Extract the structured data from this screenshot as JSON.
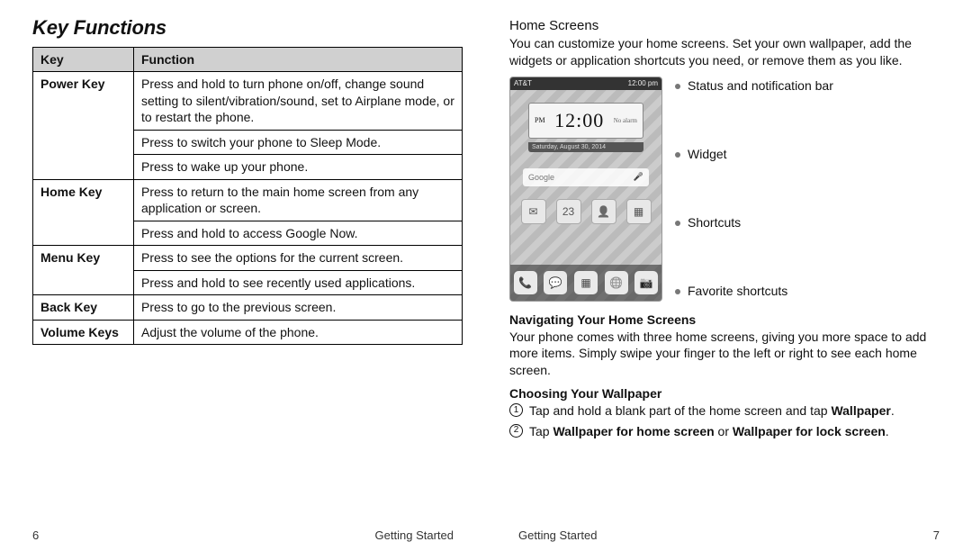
{
  "left": {
    "title": "Key Functions",
    "table": {
      "head": {
        "c1": "Key",
        "c2": "Function"
      },
      "rows": [
        {
          "key": "Power Key",
          "cells": [
            "Press and hold to turn phone on/off, change sound setting to silent/vibration/sound, set to Airplane mode, or to restart the phone.",
            "Press to switch your phone to Sleep Mode.",
            "Press to wake up your phone."
          ]
        },
        {
          "key": "Home Key",
          "cells": [
            "Press to return to the main home screen from any application or screen.",
            "Press and hold to access Google Now."
          ]
        },
        {
          "key": "Menu Key",
          "cells": [
            "Press to see the options for the current screen.",
            "Press and hold to see recently used applications."
          ]
        },
        {
          "key": "Back Key",
          "cells": [
            "Press to go to the previous screen."
          ]
        },
        {
          "key": "Volume Keys",
          "cells": [
            "Adjust the volume of the phone."
          ]
        }
      ]
    },
    "footer": {
      "pagenum": "6",
      "section": "Getting Started"
    }
  },
  "right": {
    "h1": "Home Screens",
    "p1": "You can customize your home screens. Set your own wallpaper, add the widgets or application shortcuts you need, or remove them as you like.",
    "phone": {
      "carrier": "AT&T",
      "clock_status": "12:00 pm",
      "ampm": "PM",
      "time": "12:00",
      "alarm": "No alarm",
      "date": "Saturday, August 30, 2014",
      "search": "Google",
      "shortcut_labels": [
        "Email",
        "23",
        "Contacts",
        "Apps"
      ]
    },
    "callouts": {
      "a": "Status and notification bar",
      "b": "Widget",
      "c": "Shortcuts",
      "d": "Favorite shortcuts"
    },
    "h2": "Navigating Your Home Screens",
    "p2": "Your phone comes with three home screens, giving you more space to add more items. Simply swipe your finger to the left or right to see each home screen.",
    "h3": "Choosing Your Wallpaper",
    "steps": {
      "s1a": "Tap and hold a blank part of the home screen and tap ",
      "s1b": "Wallpaper",
      "s1c": ".",
      "s2a": "Tap ",
      "s2b": "Wallpaper for home screen",
      "s2c": " or ",
      "s2d": "Wallpaper for lock screen",
      "s2e": "."
    },
    "footer": {
      "section": "Getting Started",
      "pagenum": "7"
    }
  }
}
